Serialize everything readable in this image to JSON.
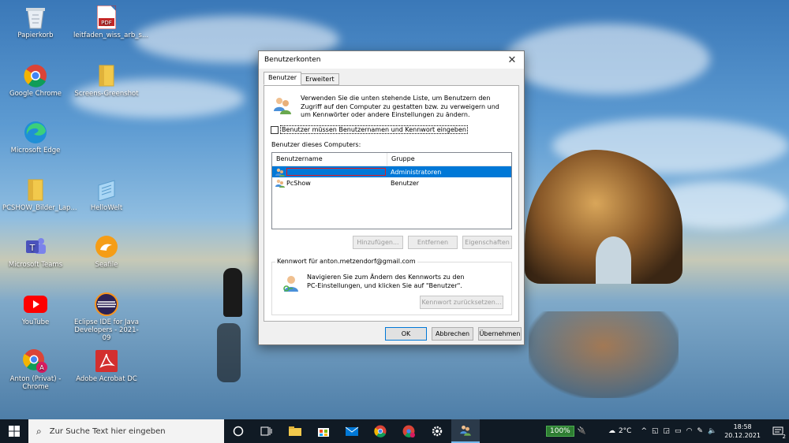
{
  "desktop": {
    "icons": [
      {
        "label": "Papierkorb",
        "icon": "recycle-bin-icon"
      },
      {
        "label": "leitfaden_wiss_arb_s...",
        "icon": "pdf-file-icon",
        "badge": "PDF"
      },
      {
        "label": "Google Chrome",
        "icon": "chrome-icon"
      },
      {
        "label": "Screens-Greenshot",
        "icon": "folder-icon"
      },
      {
        "label": "Microsoft Edge",
        "icon": "edge-icon"
      },
      {
        "label": "PCSHOW_Bilder_Lap...",
        "icon": "folder-icon"
      },
      {
        "label": "HelloWelt",
        "icon": "notepad-icon"
      },
      {
        "label": "Microsoft Teams",
        "icon": "teams-icon"
      },
      {
        "label": "Seafile",
        "icon": "seafile-icon"
      },
      {
        "label": "YouTube",
        "icon": "youtube-icon"
      },
      {
        "label": "Eclipse IDE for Java Developers - 2021-09",
        "icon": "eclipse-icon"
      },
      {
        "label": "Anton (Privat) - Chrome",
        "icon": "chrome-profile-icon",
        "badge": "A"
      },
      {
        "label": "Adobe Acrobat DC",
        "icon": "acrobat-icon"
      }
    ]
  },
  "dialog": {
    "title": "Benutzerkonten",
    "close_glyph": "✕",
    "tabs": [
      {
        "label": "Benutzer",
        "active": true
      },
      {
        "label": "Erweitert",
        "active": false
      }
    ],
    "intro_text": "Verwenden Sie die unten stehende Liste, um Benutzern den Zugriff auf den Computer zu gestatten bzw. zu verweigern und um Kennwörter oder andere Einstellungen zu ändern.",
    "require_password_checkbox": {
      "label": "Benutzer müssen Benutzernamen und Kennwort eingeben",
      "checked": false
    },
    "users_label": "Benutzer dieses Computers:",
    "columns": [
      "Benutzername",
      "Gruppe"
    ],
    "users": [
      {
        "name": "",
        "group": "Administratoren",
        "selected": true,
        "redacted": true
      },
      {
        "name": "PcShow",
        "group": "Benutzer",
        "selected": false,
        "redacted": false
      }
    ],
    "buttons": {
      "add": "Hinzufügen...",
      "remove": "Entfernen",
      "properties": "Eigenschaften"
    },
    "password_group": {
      "legend": "Kennwort für anton.metzendorf@gmail.com",
      "text": "Navigieren Sie zum Ändern des Kennworts zu den PC-Einstellungen, und klicken Sie auf \"Benutzer\".",
      "reset_button": "Kennwort zurücksetzen..."
    },
    "footer": {
      "ok": "OK",
      "cancel": "Abbrechen",
      "apply": "Übernehmen"
    }
  },
  "taskbar": {
    "search_placeholder": "Zur Suche Text hier eingeben",
    "apps": [
      "cortana-icon",
      "task-view-icon",
      "file-explorer-icon",
      "store-icon",
      "mail-icon",
      "chrome-icon",
      "chrome-profile-icon",
      "settings-icon",
      "user-accounts-icon"
    ],
    "battery_percent": "100%",
    "weather": "2°C",
    "time": "18:58",
    "date": "20.12.2021",
    "notification_count": "2"
  },
  "colors": {
    "accent": "#0078d7",
    "redaction": "#e01b24",
    "taskbar": "#101a24"
  }
}
